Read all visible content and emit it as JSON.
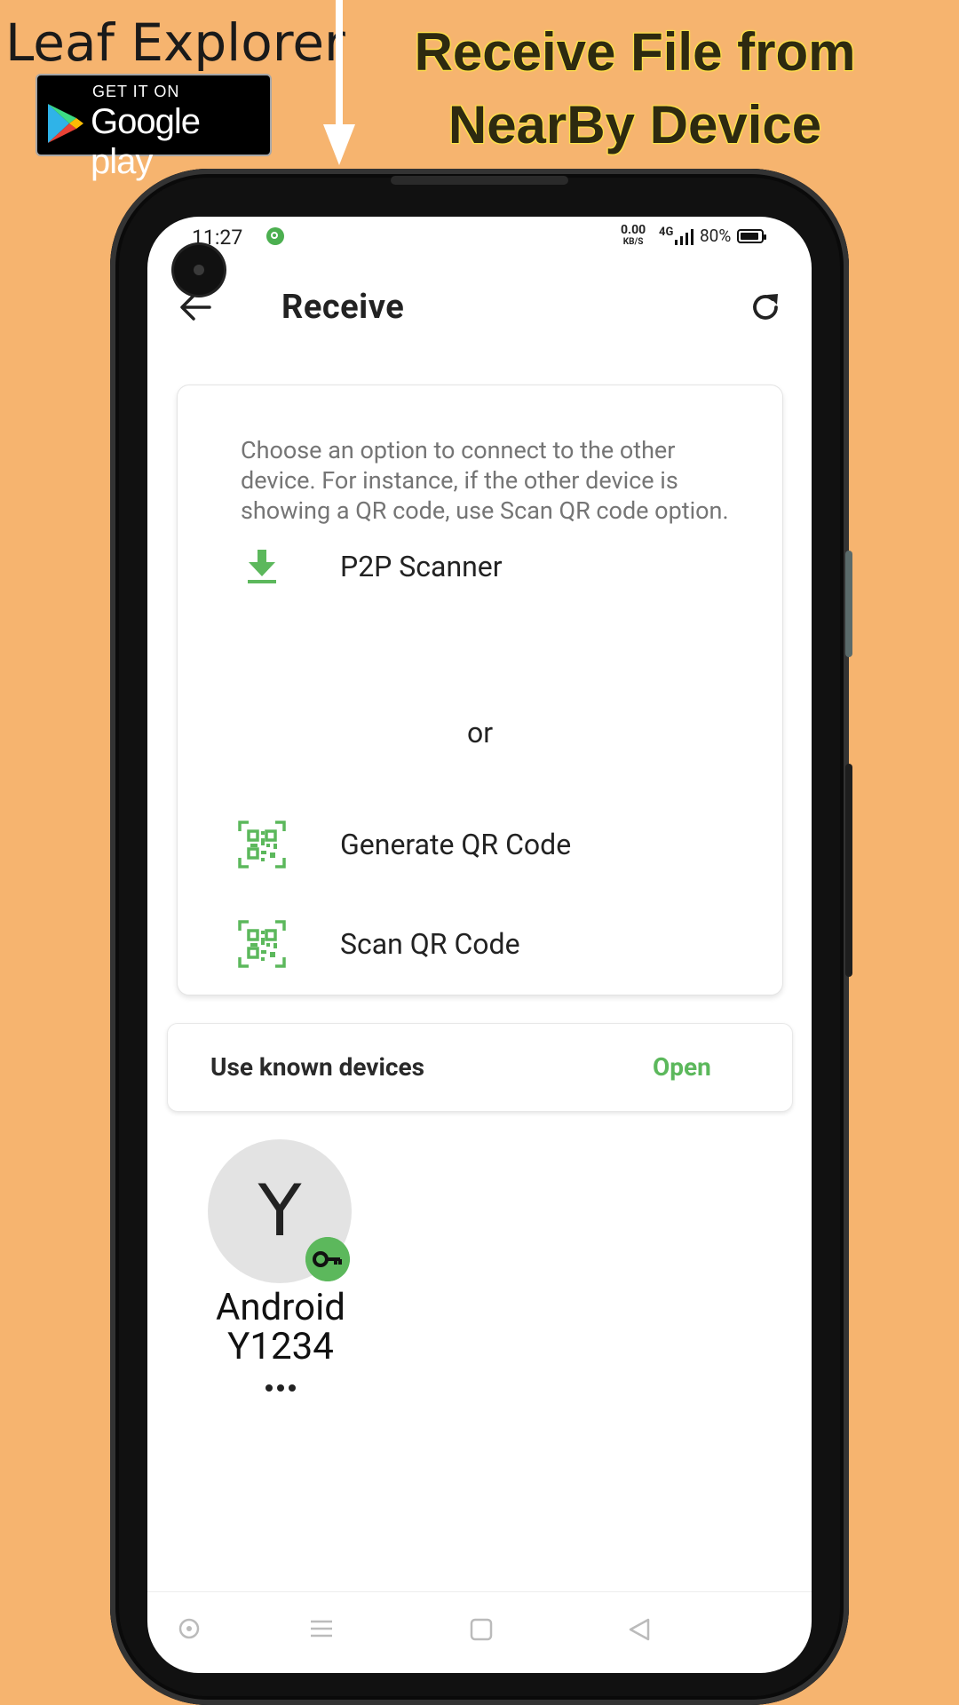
{
  "promo": {
    "app_name": "Leaf Explorer",
    "badge_top": "GET IT ON",
    "badge_store": "Google play",
    "headline_line1": "Receive File from",
    "headline_line2": "NearBy Device"
  },
  "status_bar": {
    "time": "11:27",
    "net_speed": "0.00",
    "net_unit": "KB/S",
    "network": "4G",
    "battery": "80%"
  },
  "app_bar": {
    "title": "Receive"
  },
  "card": {
    "description": "Choose an option to connect to the other device. For instance, if the other device is showing a QR code, use Scan QR code option.",
    "options": [
      {
        "label": "P2P Scanner",
        "icon": "download-icon"
      },
      {
        "label": "Generate QR Code",
        "icon": "qr-code-icon"
      },
      {
        "label": "Scan QR Code",
        "icon": "qr-code-icon"
      }
    ],
    "or_text": "or"
  },
  "known_devices": {
    "label": "Use known devices",
    "action": "Open"
  },
  "devices": [
    {
      "initial": "Y",
      "name_line1": "Android",
      "name_line2": "Y1234",
      "badge_icon": "key-icon"
    }
  ],
  "colors": {
    "accent": "#5cb85c",
    "background": "#f6b46f",
    "headline_glow": "#ffe24a"
  }
}
